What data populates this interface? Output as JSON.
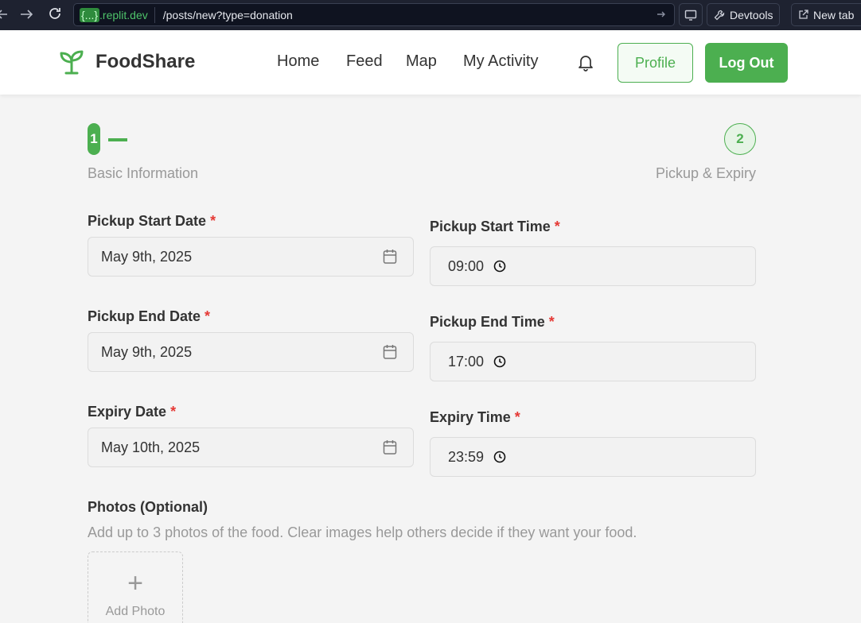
{
  "browser": {
    "back_icon": "arrow-left",
    "forward_icon": "arrow-right",
    "reload_icon": "reload",
    "url_domain_braces": "{...}",
    "url_domain_rest": ".replit.dev",
    "url_path": "/posts/new?type=donation",
    "devtools_label": "Devtools",
    "newtab_label": "New tab"
  },
  "header": {
    "brand": "FoodShare",
    "nav": [
      "Home",
      "Feed",
      "Map",
      "My Activity"
    ],
    "profile_label": "Profile",
    "logout_label": "Log Out",
    "accent": "#4caf50"
  },
  "stepper": {
    "step1_number": "1",
    "step1_label": "Basic Information",
    "step2_number": "2",
    "step2_label": "Pickup & Expiry"
  },
  "form": {
    "required_mark": "*",
    "pickup_start_date": {
      "label": "Pickup Start Date",
      "value": "May 9th, 2025"
    },
    "pickup_start_time": {
      "label": "Pickup Start Time",
      "value": "09:00"
    },
    "pickup_end_date": {
      "label": "Pickup End Date",
      "value": "May 9th, 2025"
    },
    "pickup_end_time": {
      "label": "Pickup End Time",
      "value": "17:00"
    },
    "expiry_date": {
      "label": "Expiry Date",
      "value": "May 10th, 2025"
    },
    "expiry_time": {
      "label": "Expiry Time",
      "value": "23:59"
    }
  },
  "photos": {
    "title": "Photos (Optional)",
    "description": "Add up to 3 photos of the food. Clear images help others decide if they want your food.",
    "add_label": "Add Photo",
    "add_icon": "+"
  }
}
